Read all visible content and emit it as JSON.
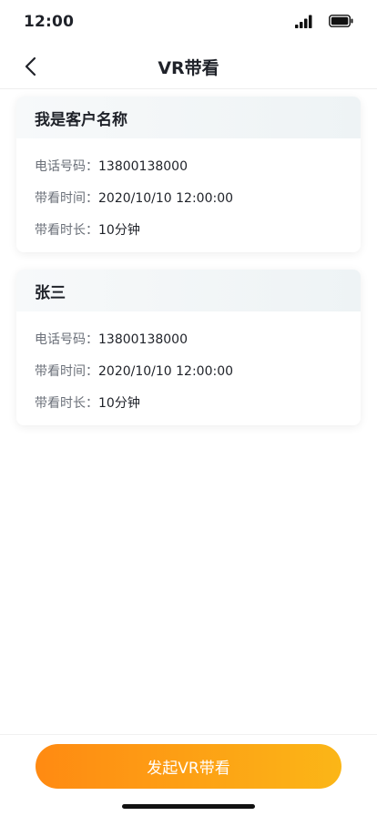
{
  "status_bar": {
    "time": "12:00"
  },
  "nav": {
    "title": "VR带看"
  },
  "labels": {
    "phone": "电话号码：",
    "viewing_time": "带看时间：",
    "duration": "带看时长："
  },
  "cards": [
    {
      "name": "我是客户名称",
      "phone": "13800138000",
      "viewing_time": "2020/10/10 12:00:00",
      "duration": "10分钟"
    },
    {
      "name": "张三",
      "phone": "13800138000",
      "viewing_time": "2020/10/10 12:00:00",
      "duration": "10分钟"
    }
  ],
  "footer": {
    "button_label": "发起VR带看"
  },
  "colors": {
    "accent_start": "#ff8a12",
    "accent_end": "#fbb617"
  }
}
